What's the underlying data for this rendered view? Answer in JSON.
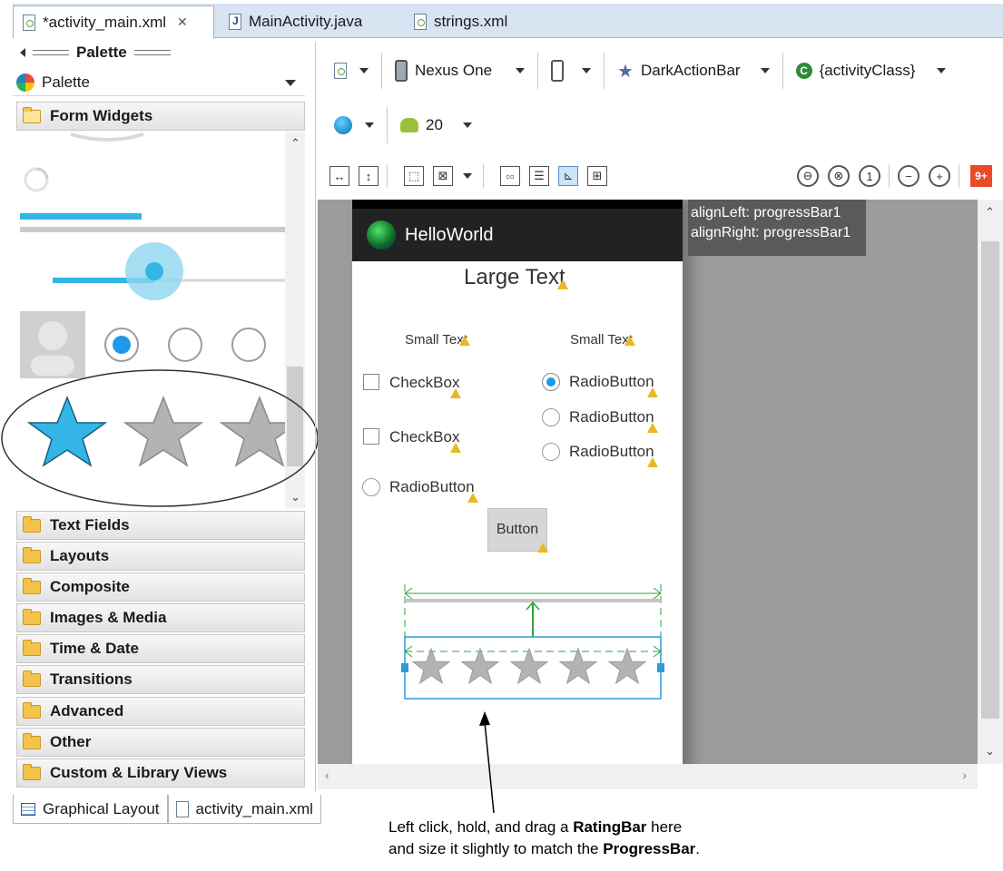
{
  "tabs": [
    {
      "label": "*activity_main.xml",
      "active": true,
      "icon": "xml-file-icon"
    },
    {
      "label": "MainActivity.java",
      "active": false,
      "icon": "java-file-icon"
    },
    {
      "label": "strings.xml",
      "active": false,
      "icon": "xml-file-icon"
    }
  ],
  "palette": {
    "header": "Palette",
    "mode_label": "Palette",
    "open_category": "Form Widgets",
    "categories": [
      "Text Fields",
      "Layouts",
      "Composite",
      "Images & Media",
      "Time & Date",
      "Transitions",
      "Advanced",
      "Other",
      "Custom & Library Views"
    ]
  },
  "bottom_tabs": [
    "Graphical Layout",
    "activity_main.xml"
  ],
  "toolbar": {
    "device": "Nexus One",
    "theme": "DarkActionBar",
    "activity": "{activityClass}",
    "api_level": "20",
    "notification_badge": "9+"
  },
  "device_preview": {
    "app_title": "HelloWorld",
    "large_text": "Large Text",
    "small_text_1": "Small Text",
    "small_text_2": "Small Text",
    "checkbox_1": "CheckBox",
    "checkbox_2": "CheckBox",
    "radio_left": "RadioButton",
    "radio_right_1": "RadioButton",
    "radio_right_2": "RadioButton",
    "radio_right_3": "RadioButton",
    "button": "Button",
    "rating_stars": 5
  },
  "tooltip": {
    "line1": "alignLeft: progressBar1",
    "line2": "alignRight: progressBar1"
  },
  "annotation": {
    "line1_pre": "Left click, hold, and drag a ",
    "line1_bold": "RatingBar",
    "line1_post": " here",
    "line2_pre": "and size it slightly to match the ",
    "line2_bold": "ProgressBar",
    "line2_post": "."
  },
  "colors": {
    "accent": "#33b5e5",
    "radio_on": "#1e9ae8",
    "guide_green": "#2ea043",
    "star_gray": "#b3b3b3"
  }
}
